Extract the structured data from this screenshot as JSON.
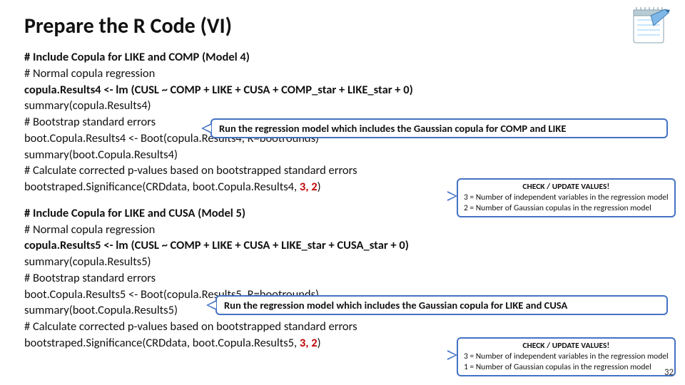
{
  "title": "Prepare the R Code (VI)",
  "page_number": "32",
  "notebook_icon": "notebook-icon",
  "block1": {
    "l1": "# Include Copula for LIKE and COMP (Model 4)",
    "l2": "# Normal copula regression",
    "l3": "copula.Results4 <- lm (CUSL ~ COMP + LIKE + CUSA + COMP_star + LIKE_star + 0)",
    "l4": "summary(copula.Results4)",
    "l5": "# Bootstrap standard errors",
    "l6": "boot.Copula.Results4 <- Boot(copula.Results4, R=bootrounds)",
    "l7": "summary(boot.Copula.Results4)",
    "l8": "# Calculate corrected p-values based on bootstrapped standard errors",
    "l9a": "bootstraped.Significance(CRDdata, boot.Copula.Results4, ",
    "l9b": "3, 2",
    "l9c": ")"
  },
  "block2": {
    "l1": "# Include Copula for LIKE and CUSA (Model 5)",
    "l2": "# Normal copula regression",
    "l3": "copula.Results5 <- lm (CUSL ~ COMP + LIKE + CUSA + LIKE_star + CUSA_star + 0)",
    "l4": "summary(copula.Results5)",
    "l5": "# Bootstrap standard errors",
    "l6": "boot.Copula.Results5 <- Boot(copula.Results5, R=bootrounds)",
    "l7": "summary(boot.Copula.Results5)",
    "l8": "# Calculate corrected p-values based on bootstrapped standard errors",
    "l9a": "bootstraped.Significance(CRDdata, boot.Copula.Results5, ",
    "l9b": "3, 2",
    "l9c": ")"
  },
  "callouts": {
    "run1": "Run the regression model which includes the Gaussian copula for COMP and LIKE",
    "run2": "Run the regression model which includes the Gaussian copula for LIKE and CUSA",
    "check1": {
      "hdr": "CHECK / UPDATE VALUES!",
      "a": "3 = Number of independent variables in the regression model",
      "b": "2 = Number of Gaussian copulas in the regression model"
    },
    "check2": {
      "hdr": "CHECK / UPDATE VALUES!",
      "a": "3 = Number of independent variables in the regression model",
      "b": "1 = Number of Gaussian copulas in the regression model"
    }
  }
}
